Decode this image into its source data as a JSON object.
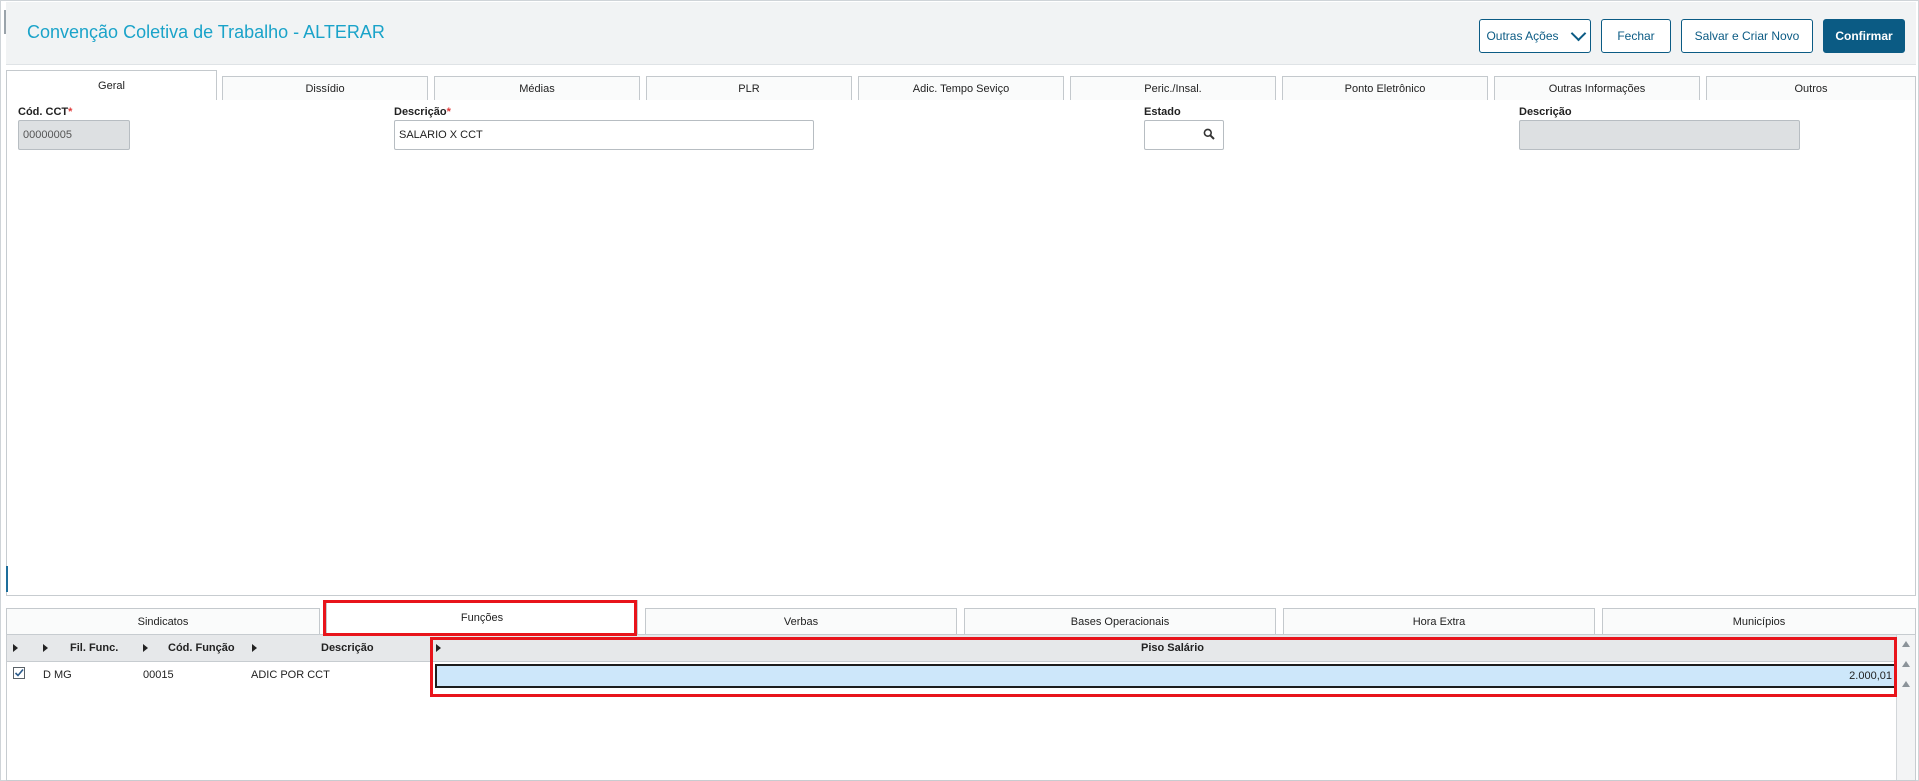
{
  "header": {
    "title": "Convenção Coletiva de Trabalho - ALTERAR",
    "buttons": {
      "other_actions": "Outras Ações",
      "close": "Fechar",
      "save_new": "Salvar e Criar Novo",
      "confirm": "Confirmar"
    }
  },
  "top_tabs": [
    "Geral",
    "Dissídio",
    "Médias",
    "PLR",
    "Adic. Tempo Seviço",
    "Peric./Insal.",
    "Ponto Eletrônico",
    "Outras Informações",
    "Outros"
  ],
  "form": {
    "cod_cct": {
      "label": "Cód. CCT",
      "required_mark": "*",
      "value": "00000005"
    },
    "descricao": {
      "label": "Descrição",
      "required_mark": "*",
      "value": "SALARIO X CCT"
    },
    "estado": {
      "label": "Estado",
      "value": ""
    },
    "descricao_estado": {
      "label": "Descrição",
      "value": ""
    }
  },
  "bottom_tabs": [
    "Sindicatos",
    "Funções",
    "Verbas",
    "Bases Operacionais",
    "Hora Extra",
    "Municípios"
  ],
  "grid": {
    "columns": [
      "Fil. Func.",
      "Cód. Função",
      "Descrição",
      "Piso Salário"
    ],
    "rows": [
      {
        "checked": true,
        "fil_func": "D MG",
        "cod_funcao": "00015",
        "descricao": "ADIC POR CCT",
        "piso_salario": "2.000,01"
      }
    ]
  },
  "colors": {
    "accent": "#0b5b84",
    "title": "#1aa3c9",
    "highlight": "#e8141b",
    "selected_cell": "#cde7fa"
  }
}
